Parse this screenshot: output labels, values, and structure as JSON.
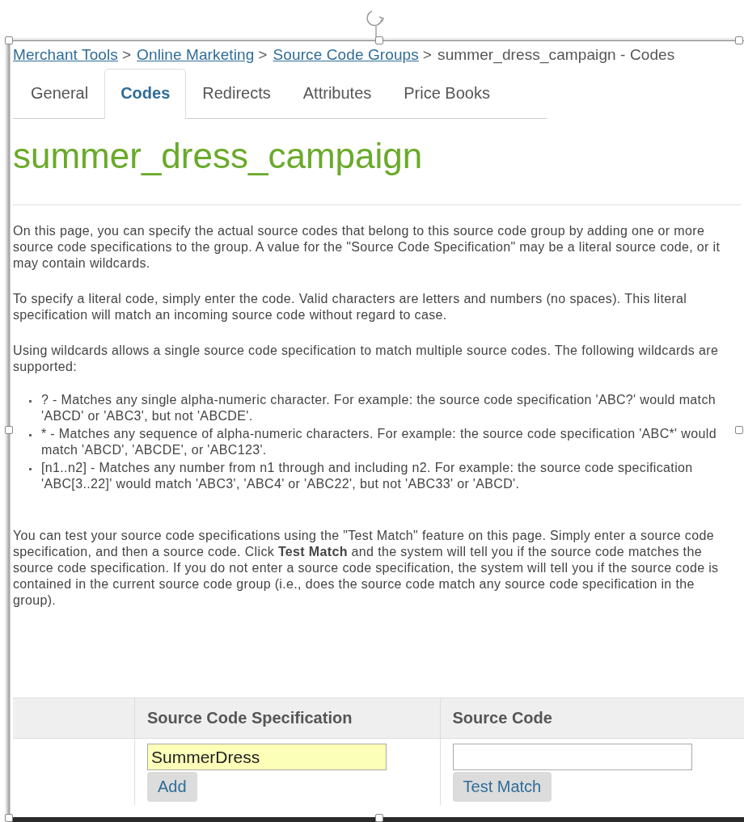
{
  "breadcrumb": [
    {
      "kind": "link",
      "text": "Merchant Tools"
    },
    {
      "kind": "separator",
      "text": ">"
    },
    {
      "kind": "link",
      "text": "Online Marketing"
    },
    {
      "kind": "separator",
      "text": ">"
    },
    {
      "kind": "link",
      "text": "Source Code Groups"
    },
    {
      "kind": "separator",
      "text": ">"
    },
    {
      "kind": "current",
      "text": "summer_dress_campaign - Codes"
    }
  ],
  "tabs": [
    {
      "label": "General",
      "selected": false
    },
    {
      "label": "Codes",
      "selected": true
    },
    {
      "label": "Redirects",
      "selected": false
    },
    {
      "label": "Attributes",
      "selected": false
    },
    {
      "label": "Price Books",
      "selected": false
    }
  ],
  "title": "summer_dress_campaign",
  "content": [
    {
      "kind": "paragraph",
      "text": "On this page, you can specify the actual source codes that belong to this source code group by adding one or more source code specifications to the group. A value for the \"Source Code Specification\" may be a literal source code, or it may contain wildcards."
    },
    {
      "kind": "paragraph",
      "text": "To specify a literal code, simply enter the code. Valid characters are letters and numbers (no spaces). This literal specification will match an incoming source code without regard to case."
    },
    {
      "kind": "paragraph",
      "text": "Using wildcards allows a single source code specification to match multiple source codes. The following wildcards are supported:"
    },
    {
      "kind": "bullets",
      "items": [
        "? - Matches any single alpha-numeric character. For example: the source code specification 'ABC?' would match 'ABCD' or 'ABC3', but not 'ABCDE'.",
        "* - Matches any sequence of alpha-numeric characters. For example: the source code specification 'ABC*' would match 'ABCD', 'ABCDE', or 'ABC123'.",
        "[n1..n2] - Matches any number from n1 through and including n2. For example: the source code specification 'ABC[3..22]' would match 'ABC3', 'ABC4' or 'ABC22', but not 'ABC33' or 'ABCD'."
      ]
    },
    {
      "kind": "paragraph",
      "text": "You can test your source code specifications using the \"Test Match\" feature on this page. Simply enter a source code specification, and then a source code. Click **Test Match** and the system will tell you if the source code matches the source code specification. If you do not enter a source code specification, the system will tell you if the source code is contained in the current source code group (i.e., does the source code match any source code specification in the group)."
    }
  ],
  "table": {
    "columns": [
      "Source Code Specification",
      "Source Code"
    ],
    "cells": [
      {
        "value": "SummerDress",
        "highlighted": true,
        "button": "Add"
      },
      {
        "highlighted": false,
        "button": "Test Match"
      }
    ]
  }
}
